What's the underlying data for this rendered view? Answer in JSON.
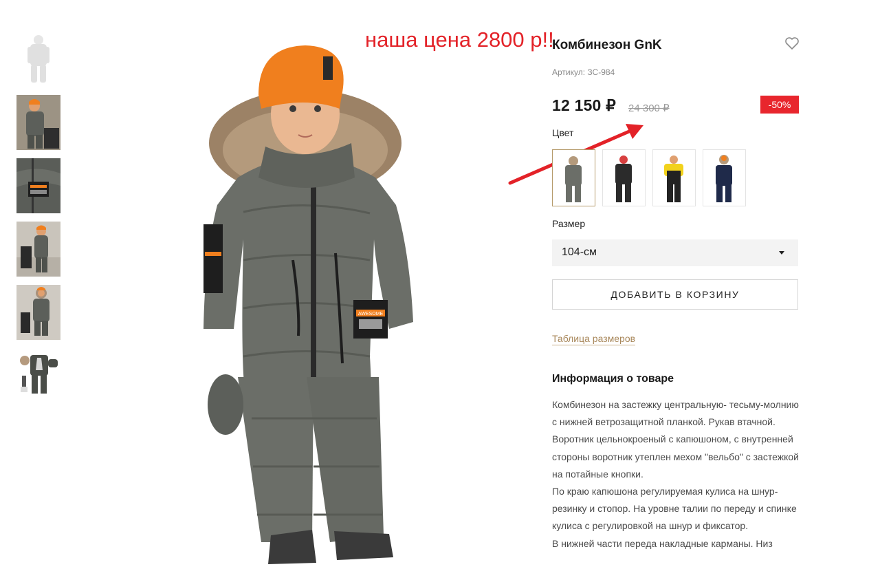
{
  "annotation": {
    "note": "наша цена 2800 р!!",
    "color": "#e32228"
  },
  "gallery": {
    "thumbnails": [
      "thumb-1",
      "thumb-2",
      "thumb-3",
      "thumb-4",
      "thumb-5",
      "thumb-6"
    ],
    "main_badge_text": "AWESOME"
  },
  "product": {
    "title": "Комбинезон GnK",
    "sku_label": "Артикул:",
    "sku_value": "ЗС-984",
    "price": "12 150 ₽",
    "old_price": "24 300 ₽",
    "discount": "-50%",
    "color_label": "Цвет",
    "swatches": [
      "grey",
      "black",
      "yellow-black",
      "navy"
    ],
    "size_label": "Размер",
    "size_selected": "104-см",
    "add_to_cart": "ДОБАВИТЬ В КОРЗИНУ",
    "size_chart_link": "Таблица размеров",
    "info_heading": "Информация о товаре",
    "info_paragraphs": [
      "Комбинезон на застежку центральную- тесьму-молнию с нижней ветрозащитной планкой. Рукав втачной.",
      "Воротник цельнокроеный с капюшоном, с внутренней стороны воротник утеплен мехом \"вельбо\" с застежкой на потайные кнопки.",
      "По краю капюшона регулируемая кулиса на шнур-резинку и стопор. На уровне талии по переду и спинке кулиса с регулировкой на шнур и фиксатор.",
      "В нижней части переда накладные карманы. Низ"
    ]
  },
  "colors": {
    "accent_gold": "#a8875a",
    "discount_red": "#e8262d",
    "jacket_grey": "#6b6e68",
    "hat_orange": "#f07f1e"
  },
  "icons": [
    "heart-icon",
    "caret-down-icon",
    "arrow-annotation-icon"
  ]
}
